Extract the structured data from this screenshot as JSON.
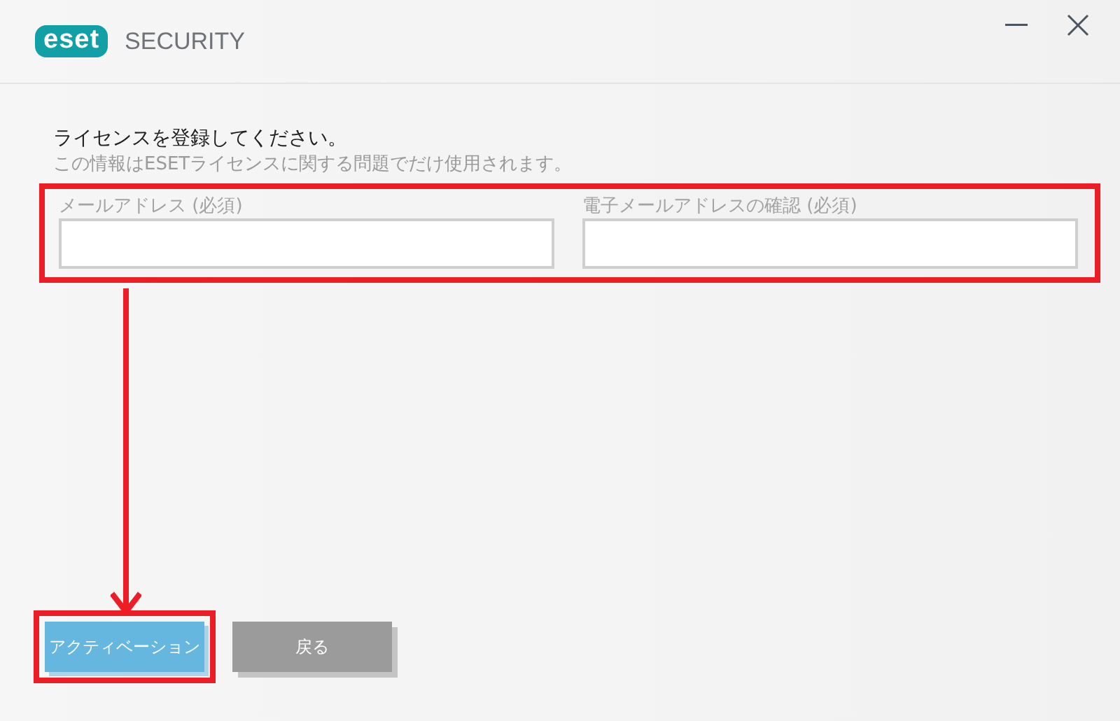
{
  "window": {
    "logo_text": "eset",
    "product": "SECURITY"
  },
  "heading": "ライセンスを登録してください。",
  "subtext": "この情報はESETライセンスに関する問題でだけ使用されます。",
  "fields": [
    {
      "label": "メールアドレス (必須)"
    },
    {
      "label": "電子メールアドレスの確認 (必須)"
    }
  ],
  "buttons": [
    {
      "label": "アクティベーション",
      "kind": "primary"
    },
    {
      "label": "戻る",
      "kind": "secondary"
    }
  ],
  "annotations": [
    {
      "kind": "frame"
    },
    {
      "kind": "arrow"
    },
    {
      "kind": "frame"
    }
  ]
}
